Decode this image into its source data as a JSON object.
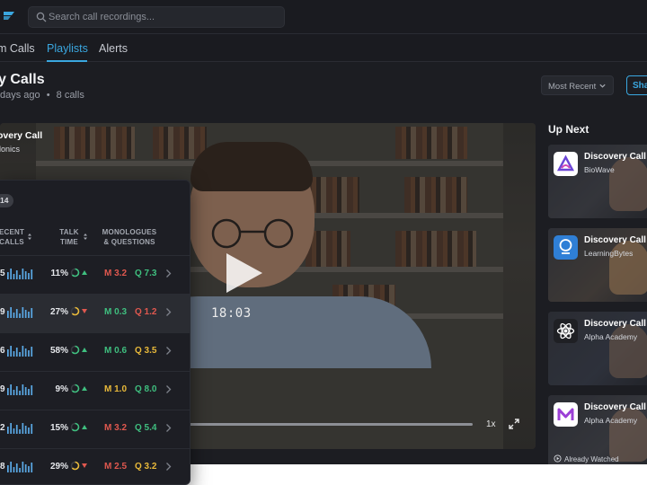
{
  "search": {
    "placeholder": "Search call recordings..."
  },
  "nav": {
    "tabs": [
      {
        "label": "m Calls"
      },
      {
        "label": "Playlists"
      },
      {
        "label": "Alerts"
      }
    ]
  },
  "page": {
    "title": "y Calls",
    "updated": "days ago",
    "count": "8 calls"
  },
  "sort": {
    "selected": "Most Recent"
  },
  "share": {
    "label": "Sha"
  },
  "video": {
    "title": "overy Call",
    "subtitle": "lonics",
    "timecode": "18:03",
    "speed": "1x"
  },
  "up_next": {
    "title": "Up Next",
    "cards": [
      {
        "title": "Discovery Call",
        "company": "BioWave",
        "logo": "biowave-logo"
      },
      {
        "title": "Discovery Call",
        "company": "LearningBytes",
        "logo": "learningbytes-logo"
      },
      {
        "title": "Discovery Call",
        "company": "Alpha Academy",
        "logo": "alpha-academy-logo"
      },
      {
        "title": "Discovery Call",
        "company": "Alpha Academy",
        "logo": "m-logo",
        "watched": "Already Watched"
      }
    ]
  },
  "table": {
    "badge": "14",
    "headers": {
      "recent_calls": [
        "ECENT",
        "CALLS"
      ],
      "talk_time": [
        "TALK",
        "TIME"
      ],
      "monologues": [
        "MONOLOGUES",
        "& QUESTIONS"
      ]
    },
    "rows": [
      {
        "num": "5",
        "talk": "11%",
        "trend": "up",
        "mono": "M 3.2",
        "mono_color": "#e0584f",
        "ques": "Q 7.3",
        "ques_color": "#3fbf7f"
      },
      {
        "num": "9",
        "talk": "27%",
        "trend": "down",
        "mono": "M 0.3",
        "mono_color": "#3fbf7f",
        "ques": "Q 1.2",
        "ques_color": "#e0584f",
        "highlight": true
      },
      {
        "num": "6",
        "talk": "58%",
        "trend": "up",
        "mono": "M 0.6",
        "mono_color": "#3fbf7f",
        "ques": "Q 3.5",
        "ques_color": "#e8b93a"
      },
      {
        "num": "9",
        "talk": "9%",
        "trend": "up",
        "mono": "M 1.0",
        "mono_color": "#e8b93a",
        "ques": "Q 8.0",
        "ques_color": "#3fbf7f"
      },
      {
        "num": "2",
        "talk": "15%",
        "trend": "up",
        "mono": "M 3.2",
        "mono_color": "#e0584f",
        "ques": "Q 5.4",
        "ques_color": "#3fbf7f"
      },
      {
        "num": "8",
        "talk": "29%",
        "trend": "down",
        "mono": "M 2.5",
        "mono_color": "#e0584f",
        "ques": "Q 3.2",
        "ques_color": "#e8b93a"
      }
    ]
  },
  "colors": {
    "accent": "#3aa7e0",
    "bg": "#1c1d22",
    "up": "#3fbf7f",
    "down": "#e0584f",
    "warn": "#e8b93a"
  }
}
